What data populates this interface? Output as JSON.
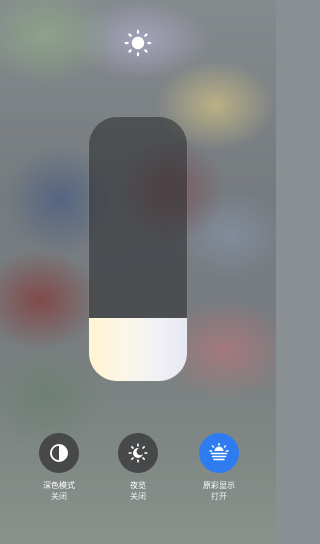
{
  "brightness": {
    "level": 0.24,
    "icon": "sun-icon"
  },
  "toggles": [
    {
      "label": "深色模式",
      "status": "关闭",
      "icon": "dark-mode-icon",
      "active": false
    },
    {
      "label": "夜览",
      "status": "关闭",
      "icon": "night-shift-icon",
      "active": false
    },
    {
      "label": "原彩显示",
      "status": "打开",
      "icon": "true-tone-icon",
      "active": true
    }
  ],
  "colors": {
    "active_toggle": "#2f7bf0",
    "inactive_toggle": "#46484a"
  }
}
